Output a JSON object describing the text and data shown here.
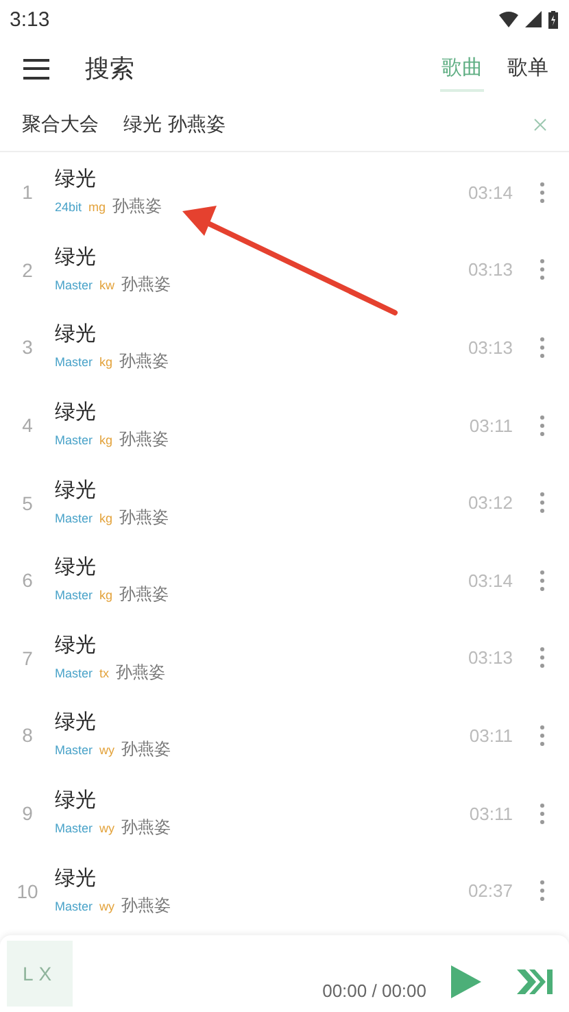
{
  "status_bar": {
    "time": "3:13"
  },
  "header": {
    "title": "搜索",
    "tabs": [
      {
        "label": "歌曲",
        "selected": true
      },
      {
        "label": "歌单",
        "selected": false
      }
    ]
  },
  "search": {
    "source": "聚合大会",
    "query": "绿光 孙燕姿"
  },
  "songs": [
    {
      "index": "1",
      "title": "绿光",
      "quality": "24bit",
      "source": "mg",
      "artist": "孙燕姿",
      "duration": "03:14"
    },
    {
      "index": "2",
      "title": "绿光",
      "quality": "Master",
      "source": "kw",
      "artist": "孙燕姿",
      "duration": "03:13"
    },
    {
      "index": "3",
      "title": "绿光",
      "quality": "Master",
      "source": "kg",
      "artist": "孙燕姿",
      "duration": "03:13"
    },
    {
      "index": "4",
      "title": "绿光",
      "quality": "Master",
      "source": "kg",
      "artist": "孙燕姿",
      "duration": "03:11"
    },
    {
      "index": "5",
      "title": "绿光",
      "quality": "Master",
      "source": "kg",
      "artist": "孙燕姿",
      "duration": "03:12"
    },
    {
      "index": "6",
      "title": "绿光",
      "quality": "Master",
      "source": "kg",
      "artist": "孙燕姿",
      "duration": "03:14"
    },
    {
      "index": "7",
      "title": "绿光",
      "quality": "Master",
      "source": "tx",
      "artist": "孙燕姿",
      "duration": "03:13"
    },
    {
      "index": "8",
      "title": "绿光",
      "quality": "Master",
      "source": "wy",
      "artist": "孙燕姿",
      "duration": "03:11"
    },
    {
      "index": "9",
      "title": "绿光",
      "quality": "Master",
      "source": "wy",
      "artist": "孙燕姿",
      "duration": "03:11"
    },
    {
      "index": "10",
      "title": "绿光",
      "quality": "Master",
      "source": "wy",
      "artist": "孙燕姿",
      "duration": "02:37"
    }
  ],
  "player": {
    "cover_text": "LX",
    "time": "00:00 / 00:00"
  }
}
